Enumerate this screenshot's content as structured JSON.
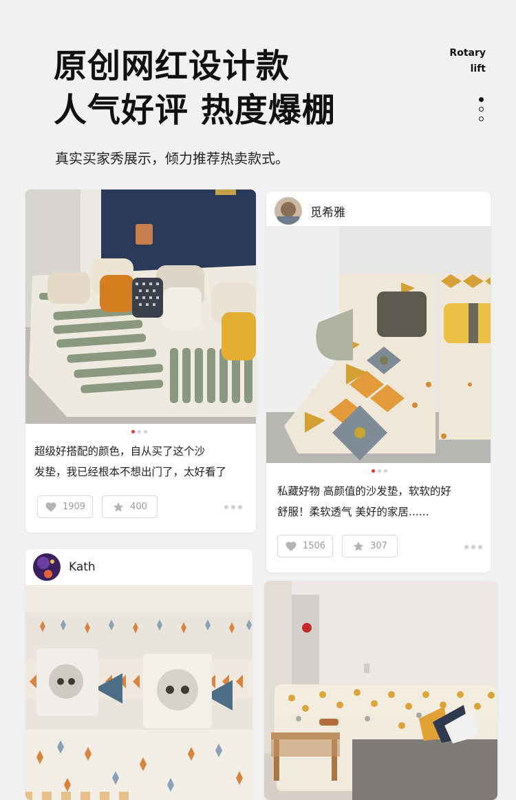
{
  "header": {
    "line1": "原创网红设计款",
    "line2": "人气好评 热度爆棚",
    "subtitle": "真实买家秀展示，倾力推荐热卖款式。",
    "brand_line1": "Rotary",
    "brand_line2": "lift"
  },
  "posts": [
    {
      "username": "",
      "caption_line1": "超级好搭配的颜色，自从买了这个沙",
      "caption_line2": "发垫，我已经根本不想出门了，太好看了",
      "likes": "1909",
      "favorites": "400",
      "like_icon": "heart-icon",
      "fav_icon": "star-icon"
    },
    {
      "username": "觅希雅",
      "caption_line1": "私藏好物 高颜值的沙发垫，软软的好",
      "caption_line2": "舒服！柔软透气 美好的家居......",
      "likes": "1506",
      "favorites": "307",
      "like_icon": "heart-icon",
      "fav_icon": "star-icon"
    },
    {
      "username": "Kath"
    },
    {
      "username": ""
    }
  ],
  "colors": {
    "accent_dot": "#e23a2e",
    "background": "#f1f1f1",
    "mustard": "#d9a53a",
    "sage": "#9aa592"
  }
}
